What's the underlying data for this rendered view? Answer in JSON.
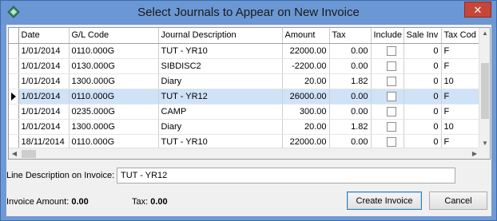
{
  "window": {
    "title": "Select Journals to Appear on New Invoice",
    "close_glyph": "✕",
    "app_icon": "diamond-app-icon"
  },
  "grid": {
    "columns": [
      "Date",
      "G/L Code",
      "Journal Description",
      "Amount",
      "Tax",
      "Include",
      "Sale Inv",
      "Tax Cod"
    ],
    "selected_row_index": 3,
    "rows": [
      {
        "date": "1/01/2014",
        "gl": "0110.000G",
        "desc": "TUT - YR10",
        "amount": "22000.00",
        "tax": "0.00",
        "include": false,
        "sale_inv": "0",
        "tax_code": "F"
      },
      {
        "date": "1/01/2014",
        "gl": "0130.000G",
        "desc": "SIBDISC2",
        "amount": "-2200.00",
        "tax": "0.00",
        "include": false,
        "sale_inv": "0",
        "tax_code": "F"
      },
      {
        "date": "1/01/2014",
        "gl": "1300.000G",
        "desc": "Diary",
        "amount": "20.00",
        "tax": "1.82",
        "include": false,
        "sale_inv": "0",
        "tax_code": "10"
      },
      {
        "date": "1/01/2014",
        "gl": "0110.000G",
        "desc": "TUT - YR12",
        "amount": "26000.00",
        "tax": "0.00",
        "include": false,
        "sale_inv": "0",
        "tax_code": "F"
      },
      {
        "date": "1/01/2014",
        "gl": "0235.000G",
        "desc": "CAMP",
        "amount": "300.00",
        "tax": "0.00",
        "include": false,
        "sale_inv": "0",
        "tax_code": "F"
      },
      {
        "date": "1/01/2014",
        "gl": "1300.000G",
        "desc": "Diary",
        "amount": "20.00",
        "tax": "1.82",
        "include": false,
        "sale_inv": "0",
        "tax_code": "10"
      },
      {
        "date": "18/11/2014",
        "gl": "0110.000G",
        "desc": "TUT - YR10",
        "amount": "22000.00",
        "tax": "0.00",
        "include": false,
        "sale_inv": "0",
        "tax_code": "F"
      }
    ]
  },
  "form": {
    "line_desc_label": "Line Description on Invoice:",
    "line_desc_value": "TUT - YR12",
    "invoice_amount_label": "Invoice Amount:",
    "invoice_amount_value": "0.00",
    "tax_label": "Tax:",
    "tax_value": "0.00"
  },
  "buttons": {
    "create_invoice": "Create Invoice",
    "cancel": "Cancel"
  },
  "colors": {
    "title_bar": "#6b97d4",
    "close_button": "#c7463a",
    "selected_row": "#cfe2f7"
  }
}
